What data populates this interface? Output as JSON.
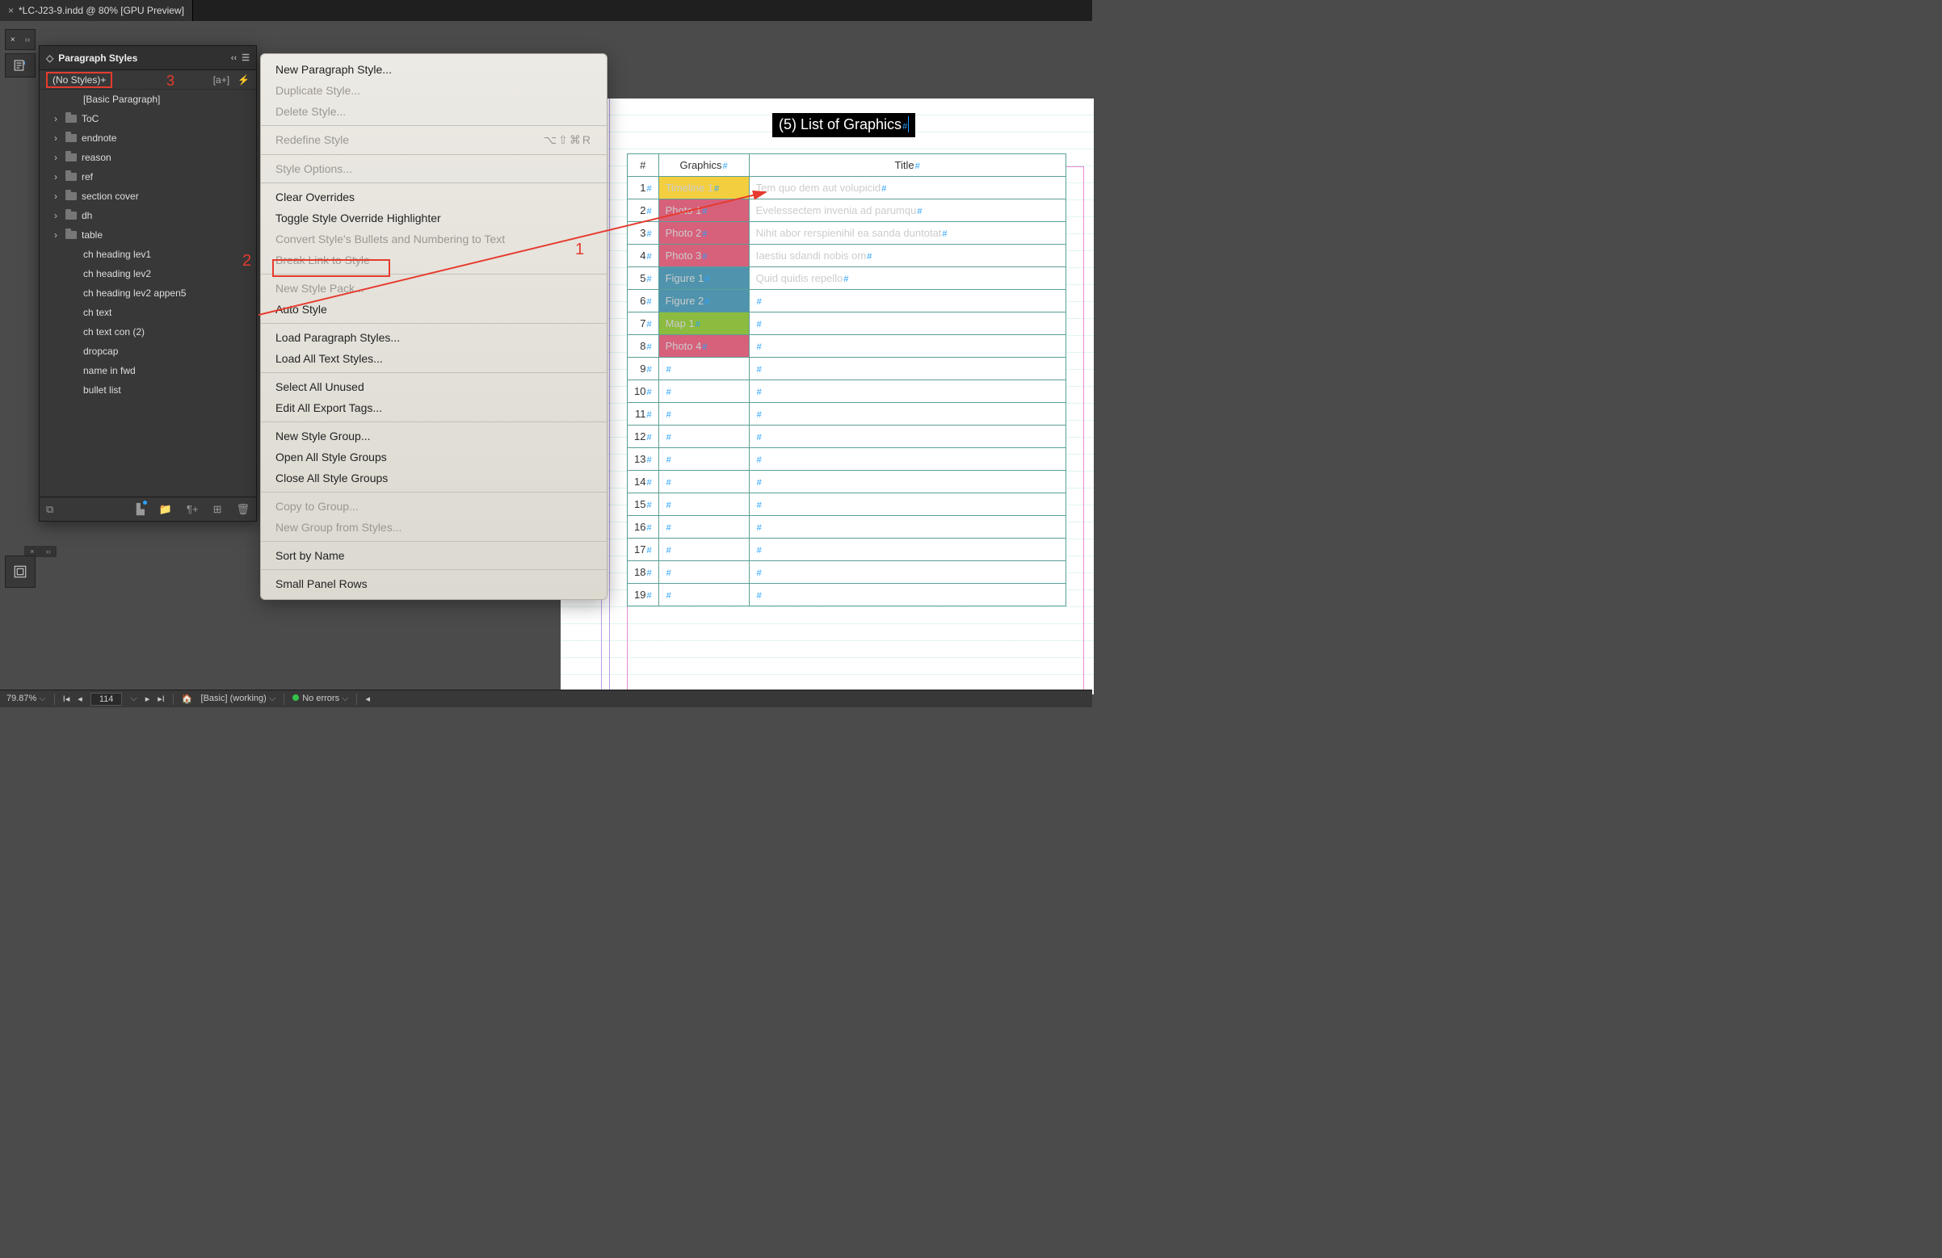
{
  "tab": {
    "title": "*LC-J23-9.indd @ 80% [GPU Preview]"
  },
  "panel": {
    "title": "Paragraph Styles",
    "currentStyle": "(No Styles)+",
    "basic": "[Basic Paragraph]",
    "folders": [
      "ToC",
      "endnote",
      "reason",
      "ref",
      "section cover",
      "dh",
      "table"
    ],
    "items": [
      "ch heading lev1",
      "ch heading lev2",
      "ch heading lev2 appen5",
      "ch text",
      "ch text con (2)",
      "dropcap",
      "name in fwd",
      "bullet list"
    ]
  },
  "menu": {
    "items": [
      {
        "label": "New Paragraph Style...",
        "disabled": false
      },
      {
        "label": "Duplicate Style...",
        "disabled": true
      },
      {
        "label": "Delete Style...",
        "disabled": true
      },
      {
        "sep": true
      },
      {
        "label": "Redefine Style",
        "disabled": true,
        "kbd": "⌥⇧⌘R"
      },
      {
        "sep": true
      },
      {
        "label": "Style Options...",
        "disabled": true
      },
      {
        "sep": true
      },
      {
        "label": "Clear Overrides",
        "disabled": false
      },
      {
        "label": "Toggle Style Override Highlighter",
        "disabled": false
      },
      {
        "label": "Convert Style's Bullets and Numbering to Text",
        "disabled": true
      },
      {
        "label": "Break Link to Style",
        "disabled": true
      },
      {
        "sep": true
      },
      {
        "label": "New Style Pack...",
        "disabled": true
      },
      {
        "label": "Auto Style",
        "disabled": false
      },
      {
        "sep": true
      },
      {
        "label": "Load Paragraph Styles...",
        "disabled": false
      },
      {
        "label": "Load All Text Styles...",
        "disabled": false
      },
      {
        "sep": true
      },
      {
        "label": "Select All Unused",
        "disabled": false
      },
      {
        "label": "Edit All Export Tags...",
        "disabled": false
      },
      {
        "sep": true
      },
      {
        "label": "New Style Group...",
        "disabled": false
      },
      {
        "label": "Open All Style Groups",
        "disabled": false
      },
      {
        "label": "Close All Style Groups",
        "disabled": false
      },
      {
        "sep": true
      },
      {
        "label": "Copy to Group...",
        "disabled": true
      },
      {
        "label": "New Group from Styles...",
        "disabled": true
      },
      {
        "sep": true
      },
      {
        "label": "Sort by Name",
        "disabled": false
      },
      {
        "sep": true
      },
      {
        "label": "Small Panel Rows",
        "disabled": false
      }
    ]
  },
  "annotations": {
    "one": "1",
    "two": "2",
    "three": "3"
  },
  "doc": {
    "title": "(5) List of Graphics",
    "headers": {
      "num": "#",
      "graphics": "Graphics",
      "title": "Title"
    },
    "rows": [
      {
        "n": "1",
        "g": "Timeline 1",
        "t": "Tem quo dem aut volupicid",
        "cls": "cyel"
      },
      {
        "n": "2",
        "g": "Photo 1",
        "t": "Evelessectem invenia ad parumqu",
        "cls": "cred"
      },
      {
        "n": "3",
        "g": "Photo 2",
        "t": "Nihit abor rerspienihil ea sanda duntotat",
        "cls": "cred"
      },
      {
        "n": "4",
        "g": "Photo 3",
        "t": "Iaestiu sdandi nobis om",
        "cls": "cred"
      },
      {
        "n": "5",
        "g": "Figure 1",
        "t": "Quid quidis repello",
        "cls": "cblu"
      },
      {
        "n": "6",
        "g": "Figure 2",
        "t": "",
        "cls": "cblu"
      },
      {
        "n": "7",
        "g": "Map 1",
        "t": "",
        "cls": "cgrn"
      },
      {
        "n": "8",
        "g": "Photo 4",
        "t": "",
        "cls": "cred"
      },
      {
        "n": "9",
        "g": "",
        "t": "",
        "cls": ""
      },
      {
        "n": "10",
        "g": "",
        "t": "",
        "cls": ""
      },
      {
        "n": "11",
        "g": "",
        "t": "",
        "cls": ""
      },
      {
        "n": "12",
        "g": "",
        "t": "",
        "cls": ""
      },
      {
        "n": "13",
        "g": "",
        "t": "",
        "cls": ""
      },
      {
        "n": "14",
        "g": "",
        "t": "",
        "cls": ""
      },
      {
        "n": "15",
        "g": "",
        "t": "",
        "cls": ""
      },
      {
        "n": "16",
        "g": "",
        "t": "",
        "cls": ""
      },
      {
        "n": "17",
        "g": "",
        "t": "",
        "cls": ""
      },
      {
        "n": "18",
        "g": "",
        "t": "",
        "cls": ""
      },
      {
        "n": "19",
        "g": "",
        "t": "",
        "cls": ""
      }
    ]
  },
  "status": {
    "zoom": "79.87%",
    "page": "114",
    "layer": "[Basic] (working)",
    "errors": "No errors"
  }
}
